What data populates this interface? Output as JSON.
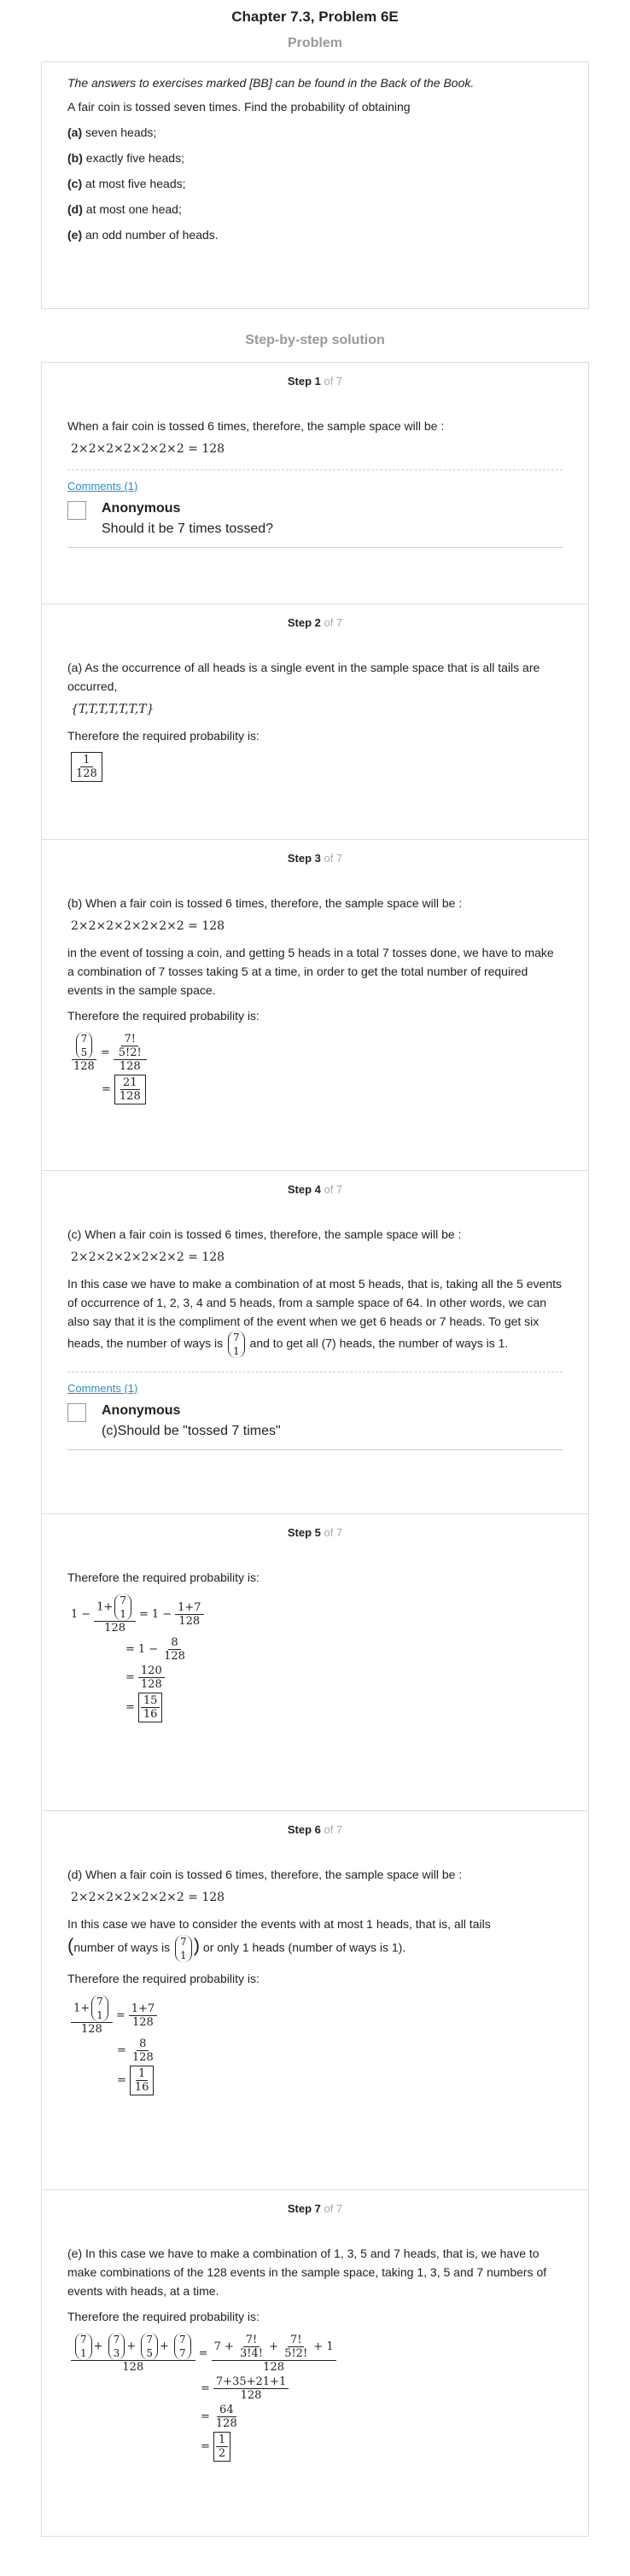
{
  "header": {
    "title": "Chapter 7.3, Problem 6E",
    "problem_heading": "Problem",
    "solution_heading": "Step-by-step solution"
  },
  "problem": {
    "note": "The answers to exercises marked [BB] can be found in the Back of the Book.",
    "intro": "A fair coin is tossed seven times. Find the probability of obtaining",
    "parts": [
      {
        "label": "(a)",
        "text": " seven heads;"
      },
      {
        "label": "(b)",
        "text": " exactly five heads;"
      },
      {
        "label": "(c)",
        "text": " at most five heads;"
      },
      {
        "label": "(d)",
        "text": " at most one head;"
      },
      {
        "label": "(e)",
        "text": " an odd number of heads."
      }
    ]
  },
  "steps": {
    "of_label": " of 7",
    "s1": {
      "title": "Step 1",
      "text": "When a fair coin is tossed 6 times, therefore, the sample space will be :",
      "math": "2×2×2×2×2×2×2 = 128",
      "comments_link": "Comments (1)",
      "comment_author": "Anonymous",
      "comment_text": "Should it be 7 times tossed?"
    },
    "s2": {
      "title": "Step 2",
      "text": "(a) As the occurrence of all heads is a single event in the sample space that is all tails are occurred,",
      "set": "{T,T,T,T,T,T,T}",
      "text2": "Therefore the required probability is:",
      "num": "1",
      "den": "128"
    },
    "s3": {
      "title": "Step 3",
      "text": "(b) When a fair coin is tossed 6 times, therefore, the sample space will be :",
      "math": "2×2×2×2×2×2×2 = 128",
      "text2": "in the event of tossing a coin, and getting 5 heads in a total 7 tosses done, we have to make a combination of 7 tosses taking 5 at a time, in order to get the total number of required events in the sample space.",
      "text3": "Therefore the required probability is:",
      "b_top": "7",
      "b_bot": "5",
      "den": "128",
      "f_num": "7!",
      "f_den": "5!2!",
      "r_num": "21",
      "r_den": "128"
    },
    "s4": {
      "title": "Step 4",
      "text": "(c) When a fair coin is tossed 6 times, therefore, the sample space will be :",
      "math": "2×2×2×2×2×2×2 = 128",
      "text2a": "In this case we have to make a combination of at most 5 heads, that is, taking all the 5 events of occurrence of 1, 2, 3, 4 and 5 heads, from a sample space of 64. In other words, we can also say that it is the compliment of the event when we get 6 heads or 7 heads. To get six heads, the number of ways is",
      "b_top": "7",
      "b_bot": "1",
      "text2b": "and to get all (7) heads, the number of ways is 1.",
      "comments_link": "Comments (1)",
      "comment_author": "Anonymous",
      "comment_text": "(c)Should be \"tossed 7 times\""
    },
    "s5": {
      "title": "Step 5",
      "text": "Therefore the required probability is:",
      "one": "1",
      "plus": "1+",
      "b_top": "7",
      "b_bot": "1",
      "den": "128",
      "num2": "1+7",
      "num3": "8",
      "num4": "120",
      "num5": "15",
      "den5": "16"
    },
    "s6": {
      "title": "Step 6",
      "text": "(d) When a fair coin is tossed 6 times, therefore, the sample space will be :",
      "math": "2×2×2×2×2×2×2 = 128",
      "text2": "In this case we have to consider the events with at most 1 heads, that is, all tails",
      "paren_text": "number of ways is",
      "b_top": "7",
      "b_bot": "1",
      "text2b": "or only 1 heads (number of ways is 1).",
      "text3": "Therefore the required probability is:",
      "den": "128",
      "num2": "1+7",
      "num3": "8",
      "r_num": "1",
      "r_den": "16"
    },
    "s7": {
      "title": "Step 7",
      "text": "(e) In this case we have to make a combination of 1, 3, 5 and 7 heads, that is, we have to make combinations of the 128 events in the sample space, taking 1, 3, 5 and 7 numbers of events with heads, at a time.",
      "text2": "Therefore the required probability is:",
      "den": "128",
      "bs": [
        "7",
        "1",
        "7",
        "3",
        "7",
        "5",
        "7",
        "7"
      ],
      "t1": "7!",
      "t1d": "3!4!",
      "t2": "7!",
      "t2d": "5!2!",
      "num2": "7+35+21+1",
      "num3": "64",
      "r_num": "1",
      "r_den": "2"
    }
  }
}
